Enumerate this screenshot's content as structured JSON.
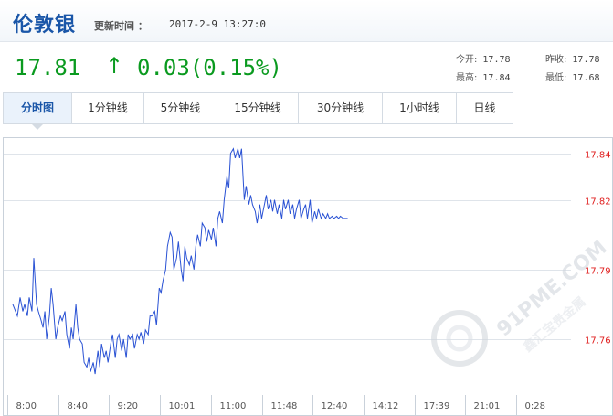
{
  "header": {
    "title": "伦敦银",
    "update_label": "更新时间 ：",
    "update_time": "2017-2-9 13:27:0"
  },
  "quote": {
    "price": "17.81",
    "direction": "↑",
    "change": "0.03(0.15%)",
    "color": "#0a9a1f"
  },
  "stats": {
    "open_label": "今开:",
    "open": "17.78",
    "prev_label": "昨收:",
    "prev": "17.78",
    "high_label": "最高:",
    "high": "17.84",
    "low_label": "最低:",
    "low": "17.68"
  },
  "tabs": [
    {
      "label": "分时图",
      "active": true
    },
    {
      "label": "1分钟线"
    },
    {
      "label": "5分钟线"
    },
    {
      "label": "15分钟线"
    },
    {
      "label": "30分钟线"
    },
    {
      "label": "1小时线"
    },
    {
      "label": "日线"
    }
  ],
  "watermark": {
    "domain": "91PME.COM",
    "tagline": "鑫汇宝贵金属"
  },
  "chart_data": {
    "type": "line",
    "series": [
      {
        "color": "#2a52d4",
        "x": [
          0,
          5,
          8,
          11,
          13,
          16,
          18,
          21,
          23,
          26,
          28,
          31,
          33,
          35,
          37,
          40,
          42,
          44,
          47,
          49,
          52,
          54,
          57,
          59,
          62,
          64,
          66,
          69,
          71,
          73,
          76,
          78,
          81,
          83,
          85,
          88,
          90,
          93,
          95,
          97,
          100,
          102,
          104,
          107,
          109,
          112,
          114,
          116,
          119,
          121,
          124,
          126,
          128,
          131,
          133,
          136,
          138,
          140,
          143,
          145,
          148,
          150,
          152,
          155,
          157,
          160,
          162,
          164,
          167,
          169,
          172,
          174,
          176,
          179,
          181,
          184,
          186,
          188,
          190,
          193,
          195,
          198,
          200,
          202,
          205,
          207,
          210,
          212,
          214,
          217,
          219,
          222,
          224,
          226,
          229,
          231,
          234,
          236,
          238,
          241,
          243,
          246,
          248,
          250,
          253,
          255,
          258,
          260,
          262,
          265,
          267,
          270,
          272,
          274,
          277,
          279,
          282,
          284,
          286,
          289,
          291,
          294,
          296,
          298,
          301,
          303,
          306,
          308,
          310,
          313,
          315,
          318,
          320,
          322,
          325,
          327,
          330,
          332,
          334,
          337,
          339,
          342,
          344,
          346,
          349,
          351,
          354,
          356,
          358,
          361,
          363,
          366
        ],
        "y": [
          17.775,
          17.77,
          17.778,
          17.772,
          17.775,
          17.77,
          17.778,
          17.772,
          17.795,
          17.775,
          17.772,
          17.768,
          17.765,
          17.772,
          17.76,
          17.77,
          17.782,
          17.775,
          17.76,
          17.765,
          17.77,
          17.768,
          17.772,
          17.762,
          17.756,
          17.765,
          17.76,
          17.775,
          17.765,
          17.76,
          17.758,
          17.75,
          17.748,
          17.752,
          17.746,
          17.75,
          17.745,
          17.755,
          17.748,
          17.758,
          17.752,
          17.755,
          17.75,
          17.758,
          17.762,
          17.752,
          17.76,
          17.762,
          17.755,
          17.76,
          17.752,
          17.762,
          17.76,
          17.762,
          17.756,
          17.762,
          17.76,
          17.763,
          17.758,
          17.764,
          17.762,
          17.77,
          17.77,
          17.772,
          17.766,
          17.782,
          17.78,
          17.785,
          17.79,
          17.8,
          17.806,
          17.804,
          17.79,
          17.795,
          17.802,
          17.79,
          17.785,
          17.8,
          17.795,
          17.792,
          17.796,
          17.79,
          17.8,
          17.805,
          17.8,
          17.81,
          17.808,
          17.802,
          17.807,
          17.803,
          17.808,
          17.8,
          17.812,
          17.815,
          17.81,
          17.82,
          17.83,
          17.825,
          17.84,
          17.842,
          17.838,
          17.842,
          17.838,
          17.842,
          17.82,
          17.826,
          17.818,
          17.822,
          17.818,
          17.815,
          17.81,
          17.818,
          17.812,
          17.816,
          17.822,
          17.816,
          17.82,
          17.815,
          17.82,
          17.814,
          17.818,
          17.812,
          17.82,
          17.816,
          17.82,
          17.814,
          17.818,
          17.812,
          17.816,
          17.82,
          17.812,
          17.816,
          17.818,
          17.812,
          17.82,
          17.81,
          17.815,
          17.812,
          17.816,
          17.812,
          17.814,
          17.812,
          17.814,
          17.812,
          17.813,
          17.812,
          17.813,
          17.812,
          17.813,
          17.812,
          17.812,
          17.812
        ]
      }
    ],
    "x_ticks": [
      "8:00",
      "8:40",
      "9:20",
      "10:01",
      "11:00",
      "11:48",
      "12:40",
      "14:12",
      "17:39",
      "21:01",
      "0:28"
    ],
    "y_ticks": [
      17.84,
      17.82,
      17.79,
      17.76
    ],
    "ylim": [
      17.736,
      17.847
    ],
    "grid": true,
    "tick_label_color": "#e02020"
  }
}
